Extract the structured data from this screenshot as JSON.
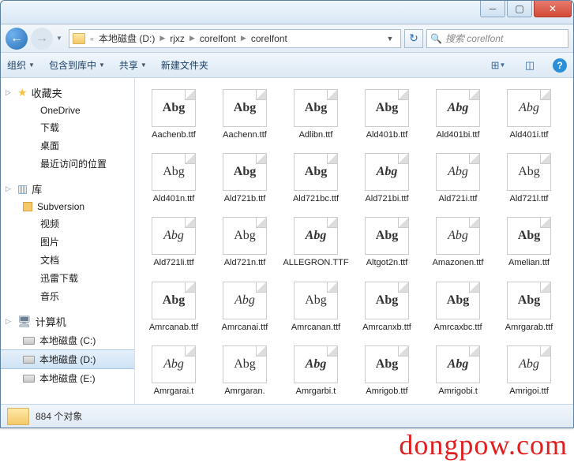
{
  "address": {
    "segments": [
      "本地磁盘 (D:)",
      "rjxz",
      "corelfont",
      "corelfont"
    ]
  },
  "search": {
    "placeholder": "搜索 corelfont"
  },
  "toolbar": {
    "organize": "组织",
    "include": "包含到库中",
    "share": "共享",
    "newfolder": "新建文件夹"
  },
  "sidebar": {
    "fav_label": "收藏夹",
    "fav_items": [
      {
        "label": "OneDrive",
        "icon": "ico-cloud"
      },
      {
        "label": "下载",
        "icon": "ico-dl"
      },
      {
        "label": "桌面",
        "icon": "ico-desk"
      },
      {
        "label": "最近访问的位置",
        "icon": "ico-clock"
      }
    ],
    "lib_label": "库",
    "lib_items": [
      {
        "label": "Subversion",
        "icon": "ico-svn"
      },
      {
        "label": "视频",
        "icon": "ico-vid"
      },
      {
        "label": "图片",
        "icon": "ico-pic"
      },
      {
        "label": "文档",
        "icon": "ico-doc"
      },
      {
        "label": "迅雷下载",
        "icon": "ico-thunder"
      },
      {
        "label": "音乐",
        "icon": "ico-music"
      }
    ],
    "comp_label": "计算机",
    "comp_items": [
      {
        "label": "本地磁盘 (C:)",
        "selected": false
      },
      {
        "label": "本地磁盘 (D:)",
        "selected": true
      },
      {
        "label": "本地磁盘 (E:)",
        "selected": false
      }
    ]
  },
  "files": [
    {
      "name": "Aachenb.ttf",
      "style": "bold"
    },
    {
      "name": "Aachenn.ttf",
      "style": "bold"
    },
    {
      "name": "Adlibn.ttf",
      "style": "bold"
    },
    {
      "name": "Ald401b.ttf",
      "style": "bold"
    },
    {
      "name": "Ald401bi.ttf",
      "style": "bolditalic"
    },
    {
      "name": "Ald401i.ttf",
      "style": "italic"
    },
    {
      "name": "Ald401n.ttf",
      "style": ""
    },
    {
      "name": "Ald721b.ttf",
      "style": "bold"
    },
    {
      "name": "Ald721bc.ttf",
      "style": "bold"
    },
    {
      "name": "Ald721bi.ttf",
      "style": "bolditalic"
    },
    {
      "name": "Ald721i.ttf",
      "style": "italic"
    },
    {
      "name": "Ald721l.ttf",
      "style": ""
    },
    {
      "name": "Ald721li.ttf",
      "style": "italic"
    },
    {
      "name": "Ald721n.ttf",
      "style": ""
    },
    {
      "name": "ALLEGRON.TTF",
      "style": "bolditalic"
    },
    {
      "name": "Altgot2n.ttf",
      "style": "bold"
    },
    {
      "name": "Amazonen.ttf",
      "style": "script"
    },
    {
      "name": "Amelian.ttf",
      "style": "bold"
    },
    {
      "name": "Amrcanab.ttf",
      "style": "bold"
    },
    {
      "name": "Amrcanai.ttf",
      "style": "italic"
    },
    {
      "name": "Amrcanan.ttf",
      "style": ""
    },
    {
      "name": "Amrcanxb.ttf",
      "style": "bold"
    },
    {
      "name": "Amrcaxbc.ttf",
      "style": "bold"
    },
    {
      "name": "Amrgarab.ttf",
      "style": "bold"
    },
    {
      "name": "Amrgarai.t",
      "style": "italic"
    },
    {
      "name": "Amrgaran.",
      "style": ""
    },
    {
      "name": "Amrgarbi.t",
      "style": "bolditalic"
    },
    {
      "name": "Amrigob.ttf",
      "style": "bold"
    },
    {
      "name": "Amrigobi.t",
      "style": "bolditalic"
    },
    {
      "name": "Amrigoi.ttf",
      "style": "italic"
    }
  ],
  "status": {
    "count": "884 个对象"
  },
  "watermark": "dongpow.com",
  "glyph": "Abg"
}
